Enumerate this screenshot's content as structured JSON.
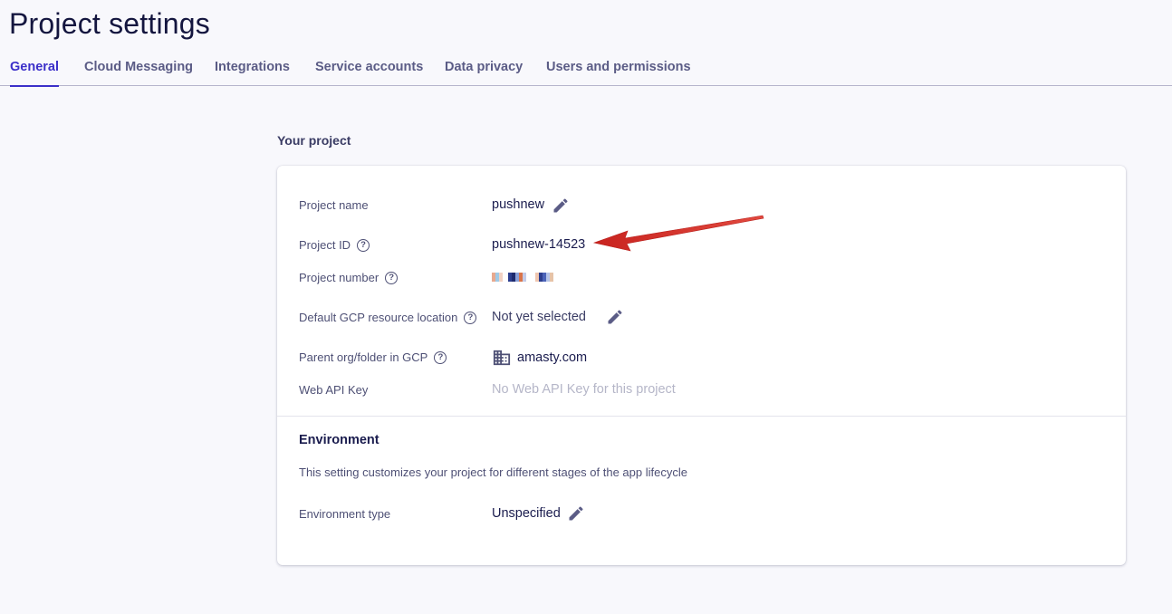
{
  "page": {
    "title": "Project settings"
  },
  "tabs": [
    {
      "label": "General",
      "active": true
    },
    {
      "label": "Cloud Messaging",
      "active": false
    },
    {
      "label": "Integrations",
      "active": false
    },
    {
      "label": "Service accounts",
      "active": false
    },
    {
      "label": "Data privacy",
      "active": false
    },
    {
      "label": "Users and permissions",
      "active": false
    }
  ],
  "project": {
    "section_label": "Your project",
    "rows": {
      "name": {
        "label": "Project name",
        "value": "pushnew"
      },
      "id": {
        "label": "Project ID",
        "value": "pushnew-14523"
      },
      "number": {
        "label": "Project number",
        "value_redacted": true
      },
      "location": {
        "label": "Default GCP resource location",
        "value": "Not yet selected"
      },
      "parent": {
        "label": "Parent org/folder in GCP",
        "value": "amasty.com"
      },
      "api_key": {
        "label": "Web API Key",
        "value": "No Web API Key for this project"
      }
    }
  },
  "environment": {
    "title": "Environment",
    "description": "This setting customizes your project for different stages of the app lifecycle",
    "type_label": "Environment type",
    "type_value": "Unspecified"
  },
  "icons": {
    "help": "?",
    "edit": "pencil-icon",
    "building": "building-icon"
  },
  "colors": {
    "accent": "#3b2fc9",
    "annotation_arrow": "#d6302b"
  }
}
